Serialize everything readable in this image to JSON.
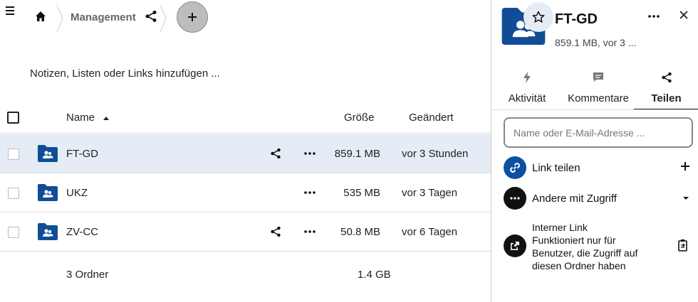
{
  "breadcrumb": {
    "current": "Management"
  },
  "notes_placeholder": "Notizen, Listen oder Links hinzufügen ...",
  "table": {
    "headers": {
      "name": "Name",
      "size": "Größe",
      "modified": "Geändert"
    },
    "rows": [
      {
        "name": "FT-GD",
        "size": "859.1 MB",
        "modified": "vor 3 Stunden",
        "shared": true,
        "selected": true
      },
      {
        "name": "UKZ",
        "size": "535 MB",
        "modified": "vor 3 Tagen",
        "shared": false,
        "selected": false
      },
      {
        "name": "ZV-CC",
        "size": "50.8 MB",
        "modified": "vor 6 Tagen",
        "shared": true,
        "selected": false
      }
    ],
    "summary": {
      "count": "3 Ordner",
      "size": "1.4 GB"
    }
  },
  "sidebar": {
    "title": "FT-GD",
    "subtitle": "859.1 MB, vor 3 ...",
    "tabs": [
      {
        "label": "Aktivität",
        "icon": "flash-icon"
      },
      {
        "label": "Kommentare",
        "icon": "comment-icon"
      },
      {
        "label": "Teilen",
        "icon": "share-icon",
        "active": true
      }
    ],
    "share_input_placeholder": "Name oder E-Mail-Adresse ...",
    "link_share_label": "Link teilen",
    "others_label": "Andere mit Zugriff",
    "internal_link": {
      "title": "Interner Link",
      "description": "Funktioniert nur für Benutzer, die Zugriff auf diesen Ordner haben"
    }
  },
  "colors": {
    "accent": "#0f4fa0",
    "selected_row": "#e5ecf5",
    "folder": "#114d96"
  }
}
